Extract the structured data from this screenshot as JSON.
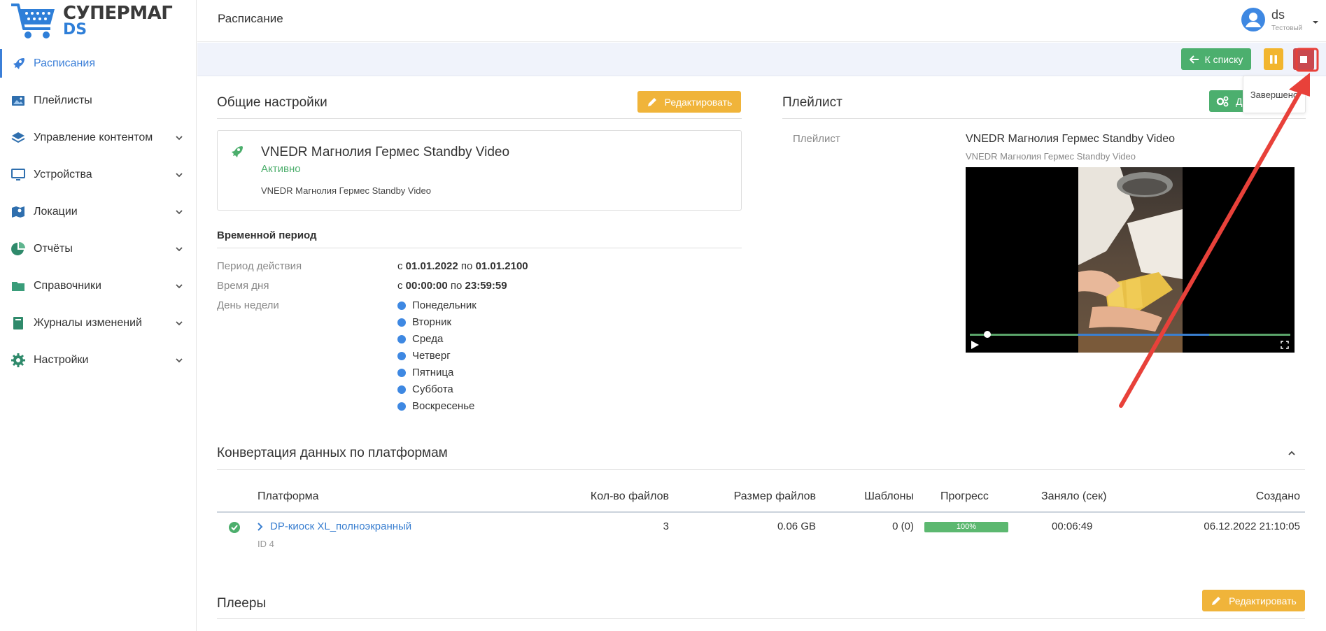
{
  "app": {
    "logo_line1": "СУПЕРМАГ",
    "logo_line2": "DS",
    "accent_color": "#3b7fd8"
  },
  "sidebar": {
    "items": [
      {
        "label": "Расписания",
        "icon": "rocket-icon",
        "active": true
      },
      {
        "label": "Плейлисты",
        "icon": "images-icon"
      },
      {
        "label": "Управление контентом",
        "icon": "layers-icon"
      },
      {
        "label": "Устройства",
        "icon": "monitor-icon"
      },
      {
        "label": "Локации",
        "icon": "map-icon"
      },
      {
        "label": "Отчёты",
        "icon": "pie-chart-icon"
      },
      {
        "label": "Справочники",
        "icon": "folder-icon"
      },
      {
        "label": "Журналы изменений",
        "icon": "book-icon"
      },
      {
        "label": "Настройки",
        "icon": "gear-icon"
      }
    ]
  },
  "header": {
    "title": "Расписание",
    "user_name": "ds",
    "user_role": "Тестовый"
  },
  "actions": {
    "back_label": "К списку",
    "tooltip": "Завершено"
  },
  "general": {
    "title": "Общие настройки",
    "edit_label": "Редактировать",
    "card_title": "VNEDR Магнолия Гермес Standby Video",
    "card_status": "Активно",
    "card_desc": "VNEDR Магнолия Гермес Standby Video"
  },
  "period": {
    "title": "Временной период",
    "valid_label": "Период действия",
    "valid_from_prefix": "с",
    "valid_from": "01.01.2022",
    "valid_to_prefix": "по",
    "valid_to": "01.01.2100",
    "time_label": "Время дня",
    "time_from_prefix": "с",
    "time_from": "00:00:00",
    "time_to_prefix": "по",
    "time_to": "23:59:59",
    "days_label": "День недели",
    "days": [
      "Понедельник",
      "Вторник",
      "Среда",
      "Четверг",
      "Пятница",
      "Суббота",
      "Воскресенье"
    ]
  },
  "playlist": {
    "title": "Плейлист",
    "btn_label": "Д",
    "label": "Плейлист",
    "name": "VNEDR Магнолия Гермес Standby Video",
    "sub": "VNEDR Магнолия Гермес Standby Video",
    "video_progress": 0.05
  },
  "conversion": {
    "title": "Конвертация данных по платформам",
    "columns": [
      "Платформа",
      "Кол-во файлов",
      "Размер файлов",
      "Шаблоны",
      "Прогресс",
      "Заняло (сек)",
      "Создано"
    ],
    "rows": [
      {
        "platform": "DP-киоск XL_полноэкранный",
        "id": "ID 4",
        "files": "3",
        "size": "0.06 GB",
        "templates": "0 (0)",
        "progress": "100%",
        "progress_value": 100,
        "took": "00:06:49",
        "created": "06.12.2022 21:10:05"
      }
    ]
  },
  "players": {
    "title": "Плееры",
    "edit_label": "Редактировать"
  }
}
